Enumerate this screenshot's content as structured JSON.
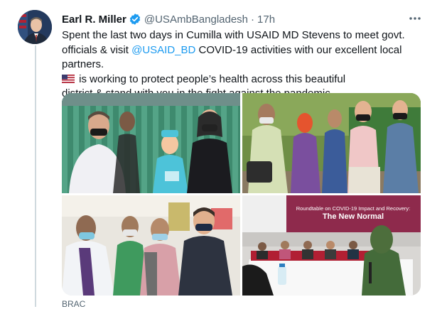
{
  "tweet": {
    "author_name": "Earl R. Miller",
    "verified_icon": "verified-badge-icon",
    "handle": "@USAmbBangladesh",
    "separator": "·",
    "timestamp": "17h",
    "more_icon": "more-horizontal-icon",
    "text": {
      "line1": "Spent the last two days in Cumilla with USAID MD Stevens to meet govt.",
      "line2_pre": "officials & visit ",
      "line2_mention": "@USAID_BD",
      "line2_post": " COVID-19 activities with our excellent local",
      "line3": "partners.",
      "line4_emoji": "flag-us-icon",
      "line4_post": " is working to protect people’s health across this beautiful",
      "line5": "district & stand with you in the fight against the pandemic."
    },
    "media": {
      "photo4_banner_title": "Roundtable on COVID-19 Impact and Recovery:",
      "photo4_banner_heading": "The New Normal"
    },
    "source_label": "BRAC"
  },
  "colors": {
    "accent": "#1d9bf0",
    "text": "#0f1419",
    "secondary": "#536471",
    "thread_line": "#cfd9de"
  }
}
